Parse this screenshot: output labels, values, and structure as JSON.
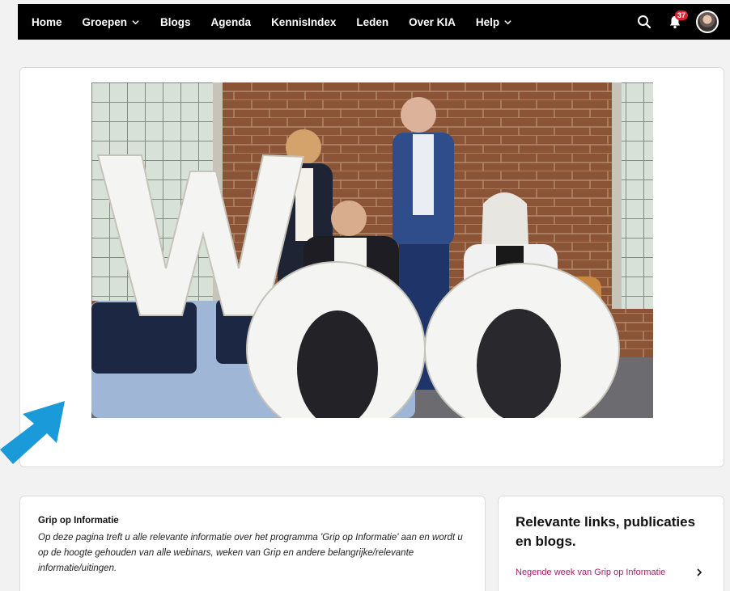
{
  "nav": {
    "items": [
      {
        "label": "Home",
        "dropdown": false
      },
      {
        "label": "Groepen",
        "dropdown": true
      },
      {
        "label": "Blogs",
        "dropdown": false
      },
      {
        "label": "Agenda",
        "dropdown": false
      },
      {
        "label": "KennisIndex",
        "dropdown": false
      },
      {
        "label": "Leden",
        "dropdown": false
      },
      {
        "label": "Over KIA",
        "dropdown": false
      },
      {
        "label": "Help",
        "dropdown": true
      }
    ],
    "notification_count": "37",
    "icons": [
      "search-icon",
      "bell-icon",
      "avatar"
    ]
  },
  "hero": {
    "photo_letters": [
      "W",
      "O",
      "O"
    ]
  },
  "info": {
    "title": "Grip op Informatie",
    "body": "Op deze pagina treft u alle relevante informatie over het programma 'Grip op Informatie' aan en wordt u op de hoogte gehouden van alle webinars, weken van Grip en andere belangrijke/relevante informatie/uitingen."
  },
  "links": {
    "title": "Relevante links, publicaties en blogs.",
    "items": [
      {
        "label": "Negende week van Grip op Informatie"
      }
    ]
  },
  "colors": {
    "nav_bg": "#000000",
    "accent_link": "#b0176a",
    "badge": "#e2202e",
    "arrow": "#1a9ad9"
  }
}
